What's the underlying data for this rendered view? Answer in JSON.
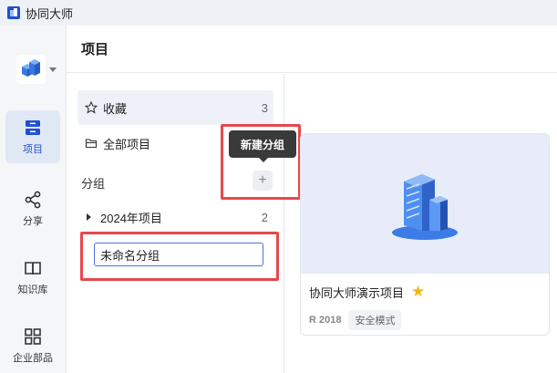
{
  "app": {
    "title": "协同大师"
  },
  "rail": {
    "items": [
      {
        "label": "项目",
        "icon": "project-icon",
        "active": true
      },
      {
        "label": "分享",
        "icon": "share-icon",
        "active": false
      },
      {
        "label": "知识库",
        "icon": "book-icon",
        "active": false
      },
      {
        "label": "企业部品",
        "icon": "grid-icon",
        "active": false
      }
    ]
  },
  "header": {
    "title": "项目"
  },
  "nav": {
    "favorites": {
      "label": "收藏",
      "count": "3"
    },
    "all": {
      "label": "全部项目"
    },
    "group_heading": "分组",
    "tooltip": "新建分组",
    "groups": [
      {
        "label": "2024年项目",
        "count": "2"
      }
    ],
    "new_group_input": {
      "value": "未命名分组",
      "placeholder": ""
    }
  },
  "card": {
    "title": "协同大师演示项目",
    "version": "R 2018",
    "badge": "安全模式",
    "starred": true
  },
  "colors": {
    "accent": "#1f4fd6",
    "highlight": "#e5484d",
    "star": "#f5b40f"
  }
}
